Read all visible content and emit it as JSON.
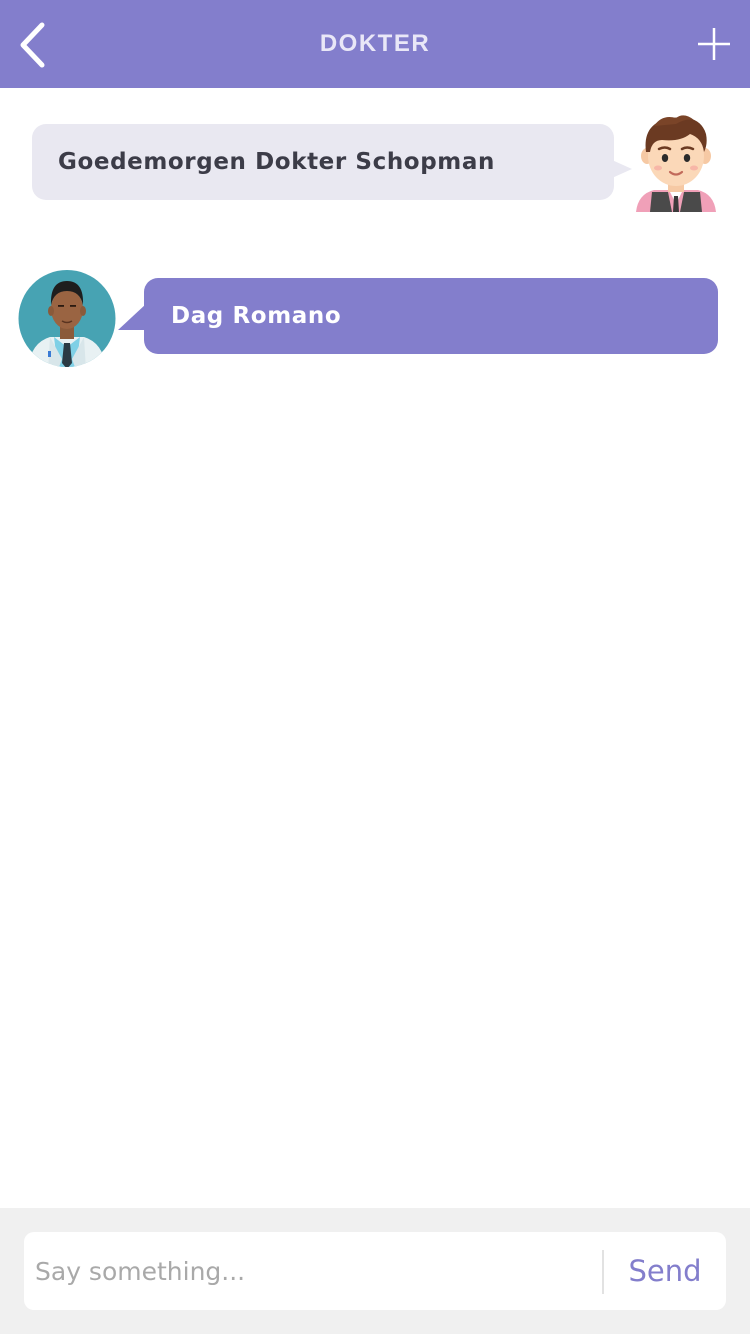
{
  "header": {
    "title": "DOKTER",
    "back_icon": "chevron-left-icon",
    "add_icon": "plus-icon",
    "background": "#837ecc"
  },
  "messages": [
    {
      "sender": "user",
      "text": "Goedemorgen Dokter Schopman",
      "avatar": "boy-avatar-icon",
      "bubble_color": "#e9e8f1"
    },
    {
      "sender": "doctor",
      "text": "Dag Romano",
      "avatar": "doctor-avatar-icon",
      "bubble_color": "#837ecc"
    }
  ],
  "composer": {
    "placeholder": "Say something...",
    "send_label": "Send",
    "accent": "#837ecc"
  }
}
